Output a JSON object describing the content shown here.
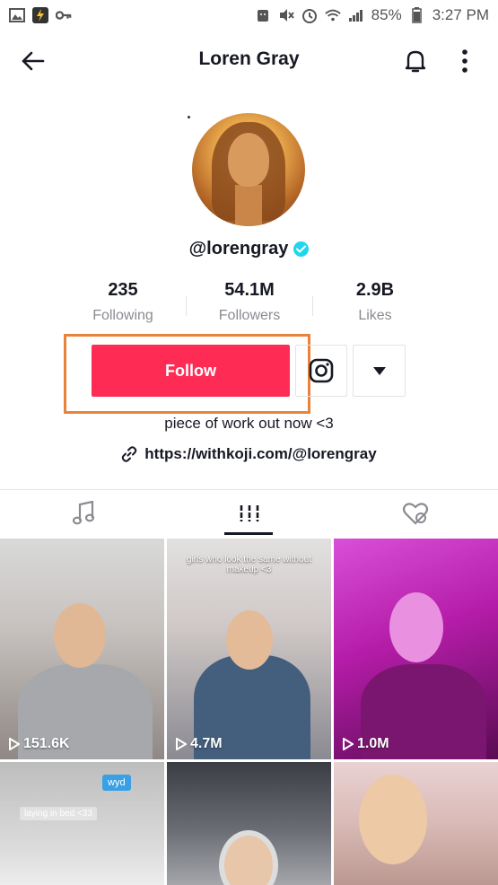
{
  "status_bar": {
    "battery": "85%",
    "time": "3:27 PM"
  },
  "header": {
    "title": "Loren Gray"
  },
  "profile": {
    "username": "@lorengray",
    "stats": [
      {
        "value": "235",
        "label": "Following"
      },
      {
        "value": "54.1M",
        "label": "Followers"
      },
      {
        "value": "2.9B",
        "label": "Likes"
      }
    ],
    "follow_label": "Follow",
    "bio": "piece of work out now <3",
    "link": "https://withkoji.com/@lorengray"
  },
  "videos": [
    {
      "views": "151.6K"
    },
    {
      "views": "4.7M",
      "caption": "girls who look the same without makeup <3"
    },
    {
      "views": "1.0M"
    },
    {
      "tag": "laying in bed <33",
      "badge": "wyd"
    },
    {},
    {}
  ],
  "colors": {
    "accent": "#fe2c55",
    "highlight": "#e9833b",
    "verified": "#20d5ec"
  }
}
